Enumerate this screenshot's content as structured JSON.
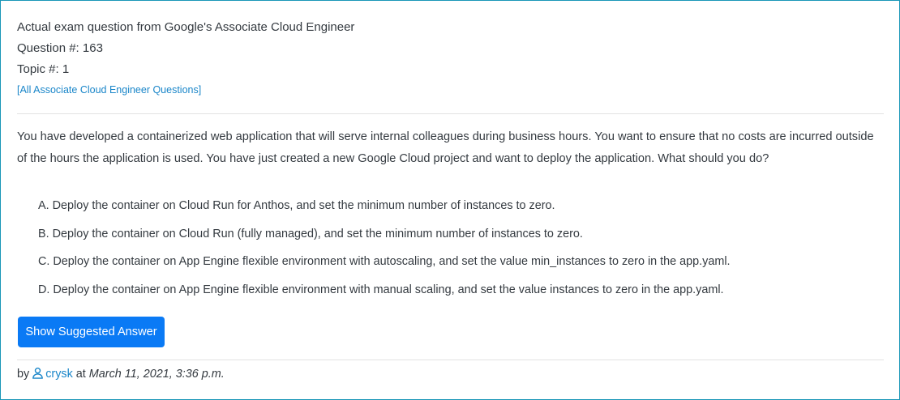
{
  "header": {
    "line1": "Actual exam question from Google's Associate Cloud Engineer",
    "question_number": "Question #: 163",
    "topic_number": "Topic #: 1",
    "all_questions_link": "[All Associate Cloud Engineer Questions]"
  },
  "question": {
    "text": "You have developed a containerized web application that will serve internal colleagues during business hours. You want to ensure that no costs are incurred outside of the hours the application is used. You have just created a new Google Cloud project and want to deploy the application. What should you do?"
  },
  "choices": [
    "A. Deploy the container on Cloud Run for Anthos, and set the minimum number of instances to zero.",
    "B. Deploy the container on Cloud Run (fully managed), and set the minimum number of instances to zero.",
    "C. Deploy the container on App Engine flexible environment with autoscaling, and set the value min_instances to zero in the app.yaml.",
    "D. Deploy the container on App Engine flexible environment with manual scaling, and set the value instances to zero in the app.yaml."
  ],
  "actions": {
    "show_answer_label": "Show Suggested Answer"
  },
  "footer": {
    "by_label": "by",
    "username": "crysk",
    "at_label": "at",
    "date": "March 11, 2021, 3:36 p.m."
  },
  "colors": {
    "accent": "#0a7af5",
    "link": "#1a86c9",
    "border": "#1a97b8"
  },
  "icons": {
    "user": "user-icon"
  }
}
